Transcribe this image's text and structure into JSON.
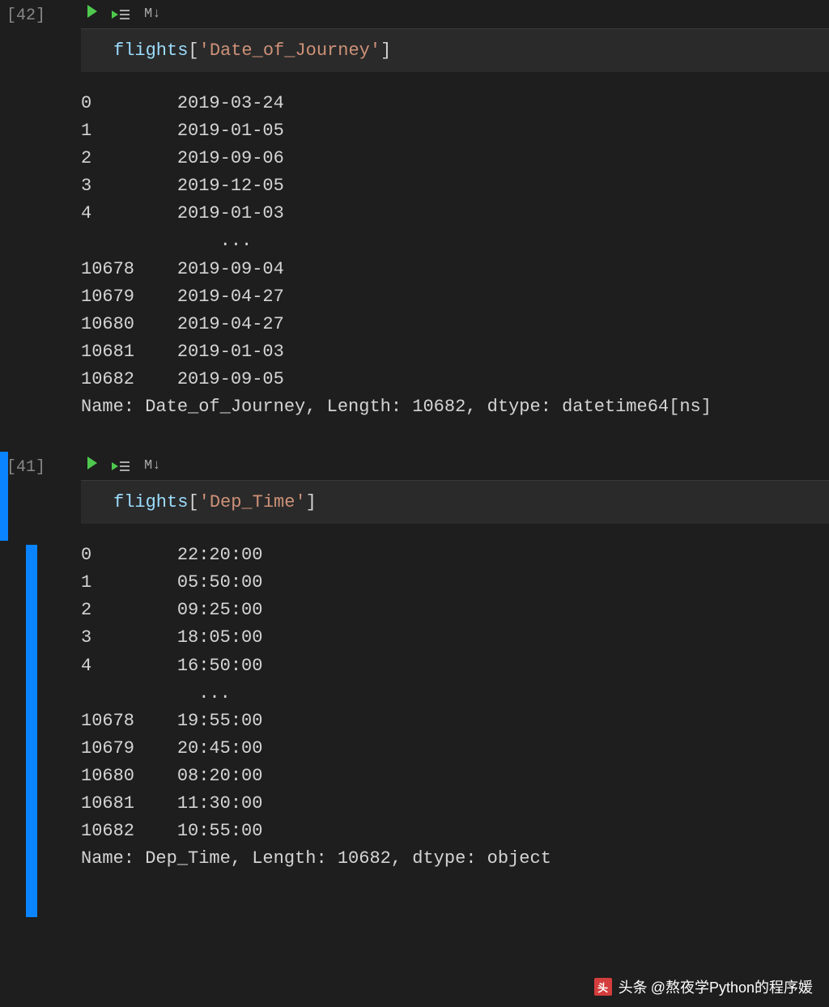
{
  "cells": [
    {
      "exec_count": "[42]",
      "md_label": "M↓",
      "code": {
        "var": "flights",
        "key": "'Date_of_Journey'"
      },
      "output_rows": [
        {
          "idx": "0",
          "val": "2019-03-24"
        },
        {
          "idx": "1",
          "val": "2019-01-05"
        },
        {
          "idx": "2",
          "val": "2019-09-06"
        },
        {
          "idx": "3",
          "val": "2019-12-05"
        },
        {
          "idx": "4",
          "val": "2019-01-03"
        },
        {
          "idx": "",
          "val": "    ...    "
        },
        {
          "idx": "10678",
          "val": "2019-09-04"
        },
        {
          "idx": "10679",
          "val": "2019-04-27"
        },
        {
          "idx": "10680",
          "val": "2019-04-27"
        },
        {
          "idx": "10681",
          "val": "2019-01-03"
        },
        {
          "idx": "10682",
          "val": "2019-09-05"
        }
      ],
      "footer": "Name: Date_of_Journey, Length: 10682, dtype: datetime64[ns]"
    },
    {
      "exec_count": "[41]",
      "md_label": "M↓",
      "code": {
        "var": "flights",
        "key": "'Dep_Time'"
      },
      "output_rows": [
        {
          "idx": "0",
          "val": "22:20:00"
        },
        {
          "idx": "1",
          "val": "05:50:00"
        },
        {
          "idx": "2",
          "val": "09:25:00"
        },
        {
          "idx": "3",
          "val": "18:05:00"
        },
        {
          "idx": "4",
          "val": "16:50:00"
        },
        {
          "idx": "",
          "val": "  ...   "
        },
        {
          "idx": "10678",
          "val": "19:55:00"
        },
        {
          "idx": "10679",
          "val": "20:45:00"
        },
        {
          "idx": "10680",
          "val": "08:20:00"
        },
        {
          "idx": "10681",
          "val": "11:30:00"
        },
        {
          "idx": "10682",
          "val": "10:55:00"
        }
      ],
      "footer": "Name: Dep_Time, Length: 10682, dtype: object"
    }
  ],
  "watermark": {
    "prefix": "头条",
    "author": "@熬夜学Python的程序媛"
  }
}
